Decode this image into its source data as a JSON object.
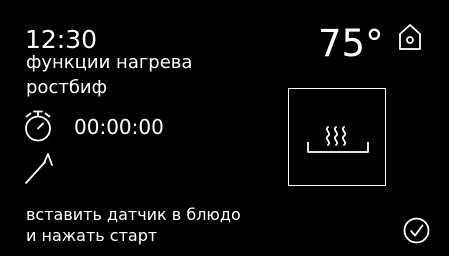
{
  "status": {
    "clock": "12:30",
    "temperature": "75°"
  },
  "program": {
    "mode_title": "функции нагрева",
    "program_name": "ростбиф",
    "timer_value": "00:00:00"
  },
  "instruction": {
    "line1": "вставить датчик в блюдо",
    "line2": "и нажать старт"
  },
  "icons": {
    "home": "home-icon",
    "timer": "stopwatch-icon",
    "probe": "meat-probe-icon",
    "heating_mode": "bottom-heat-icon",
    "confirm": "checkmark-circle-icon"
  },
  "colors": {
    "background": "#000000",
    "foreground": "#ffffff"
  }
}
